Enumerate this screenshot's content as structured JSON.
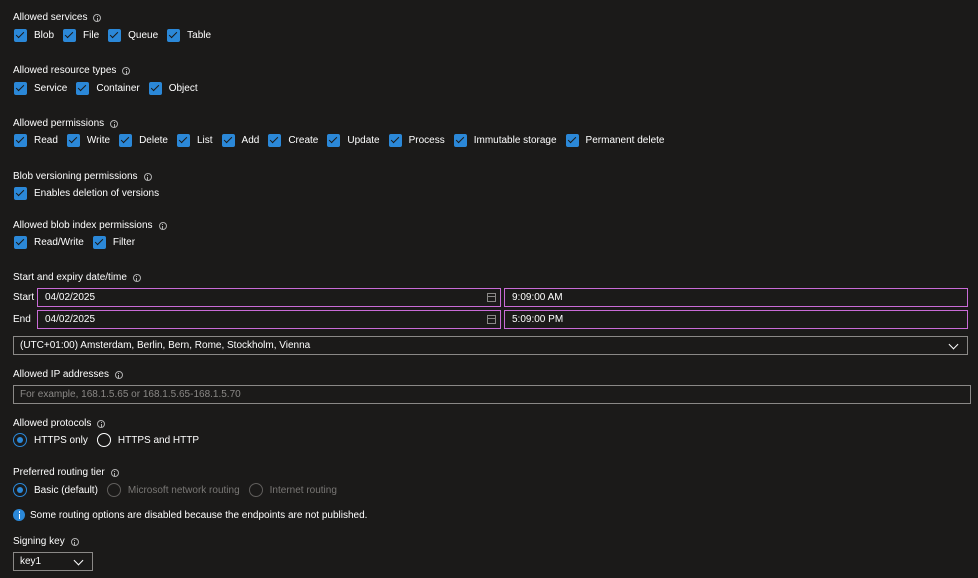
{
  "allowed_services": {
    "label": "Allowed services",
    "items": [
      {
        "label": "Blob",
        "checked": true
      },
      {
        "label": "File",
        "checked": true
      },
      {
        "label": "Queue",
        "checked": true
      },
      {
        "label": "Table",
        "checked": true
      }
    ]
  },
  "allowed_resource_types": {
    "label": "Allowed resource types",
    "items": [
      {
        "label": "Service",
        "checked": true
      },
      {
        "label": "Container",
        "checked": true
      },
      {
        "label": "Object",
        "checked": true
      }
    ]
  },
  "allowed_permissions": {
    "label": "Allowed permissions",
    "items": [
      {
        "label": "Read",
        "checked": true
      },
      {
        "label": "Write",
        "checked": true
      },
      {
        "label": "Delete",
        "checked": true
      },
      {
        "label": "List",
        "checked": true
      },
      {
        "label": "Add",
        "checked": true
      },
      {
        "label": "Create",
        "checked": true
      },
      {
        "label": "Update",
        "checked": true
      },
      {
        "label": "Process",
        "checked": true
      },
      {
        "label": "Immutable storage",
        "checked": true
      },
      {
        "label": "Permanent delete",
        "checked": true
      }
    ]
  },
  "blob_versioning": {
    "label": "Blob versioning permissions",
    "items": [
      {
        "label": "Enables deletion of versions",
        "checked": true
      }
    ]
  },
  "blob_index": {
    "label": "Allowed blob index permissions",
    "items": [
      {
        "label": "Read/Write",
        "checked": true
      },
      {
        "label": "Filter",
        "checked": true
      }
    ]
  },
  "datetime": {
    "label": "Start and expiry date/time",
    "start_label": "Start",
    "start_date": "04/02/2025",
    "start_time": "9:09:00 AM",
    "end_label": "End",
    "end_date": "04/02/2025",
    "end_time": "5:09:00 PM",
    "timezone": "(UTC+01:00) Amsterdam, Berlin, Bern, Rome, Stockholm, Vienna"
  },
  "allowed_ip": {
    "label": "Allowed IP addresses",
    "placeholder": "For example, 168.1.5.65 or 168.1.5.65-168.1.5.70"
  },
  "protocols": {
    "label": "Allowed protocols",
    "options": [
      {
        "label": "HTTPS only",
        "selected": true
      },
      {
        "label": "HTTPS and HTTP",
        "selected": false
      }
    ]
  },
  "routing": {
    "label": "Preferred routing tier",
    "options": [
      {
        "label": "Basic (default)",
        "selected": true,
        "disabled": false
      },
      {
        "label": "Microsoft network routing",
        "selected": false,
        "disabled": true
      },
      {
        "label": "Internet routing",
        "selected": false,
        "disabled": true
      }
    ],
    "notice": "Some routing options are disabled because the endpoints are not published."
  },
  "signing_key": {
    "label": "Signing key",
    "value": "key1"
  },
  "colors": {
    "background": "#1b1a19",
    "accent": "#2b88d8",
    "focus_border": "#c96bd6",
    "border": "#8a8886"
  }
}
